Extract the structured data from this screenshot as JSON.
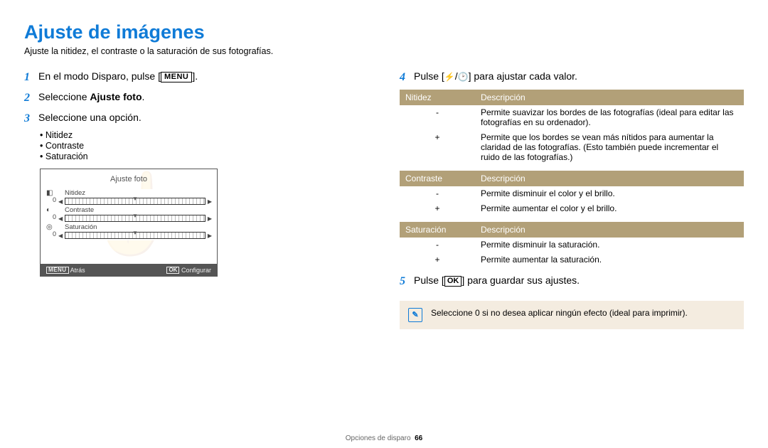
{
  "title": "Ajuste de imágenes",
  "subtitle": "Ajuste la nitidez, el contraste o la saturación de sus fotografías.",
  "left": {
    "step1_a": "En el modo Disparo, pulse [",
    "step1_b": "].",
    "step2_a": "Seleccione ",
    "step2_b": "Ajuste foto",
    "step2_c": ".",
    "step3": "Seleccione una opción.",
    "opts": [
      "Nitidez",
      "Contraste",
      "Saturación"
    ],
    "lcd": {
      "title": "Ajuste foto",
      "rows": [
        "Nitidez",
        "Contraste",
        "Saturación"
      ],
      "back": "Atrás",
      "confirm": "Configurar"
    }
  },
  "right": {
    "step4_a": "Pulse [",
    "step4_b": "/",
    "step4_c": "] para ajustar cada valor.",
    "step5_a": "Pulse [",
    "step5_b": "] para guardar sus ajustes.",
    "tables": {
      "nitidez": {
        "h1": "Nitidez",
        "h2": "Descripción",
        "r1": "Permite suavizar los bordes de las fotografías (ideal para editar las fotografías en su ordenador).",
        "r2": "Permite que los bordes se vean más nítidos para aumentar la claridad de las fotografías. (Esto también puede incrementar el ruido de las fotografías.)"
      },
      "contraste": {
        "h1": "Contraste",
        "h2": "Descripción",
        "r1": "Permite disminuir el color y el brillo.",
        "r2": "Permite aumentar el color y el brillo."
      },
      "saturacion": {
        "h1": "Saturación",
        "h2": "Descripción",
        "r1": "Permite disminuir la saturación.",
        "r2": "Permite aumentar la saturación."
      }
    },
    "note": "Seleccione 0 si no desea aplicar ningún efecto (ideal para imprimir)."
  },
  "footer": {
    "section": "Opciones de disparo",
    "page": "66"
  },
  "sym": {
    "minus": "-",
    "plus": "+"
  }
}
